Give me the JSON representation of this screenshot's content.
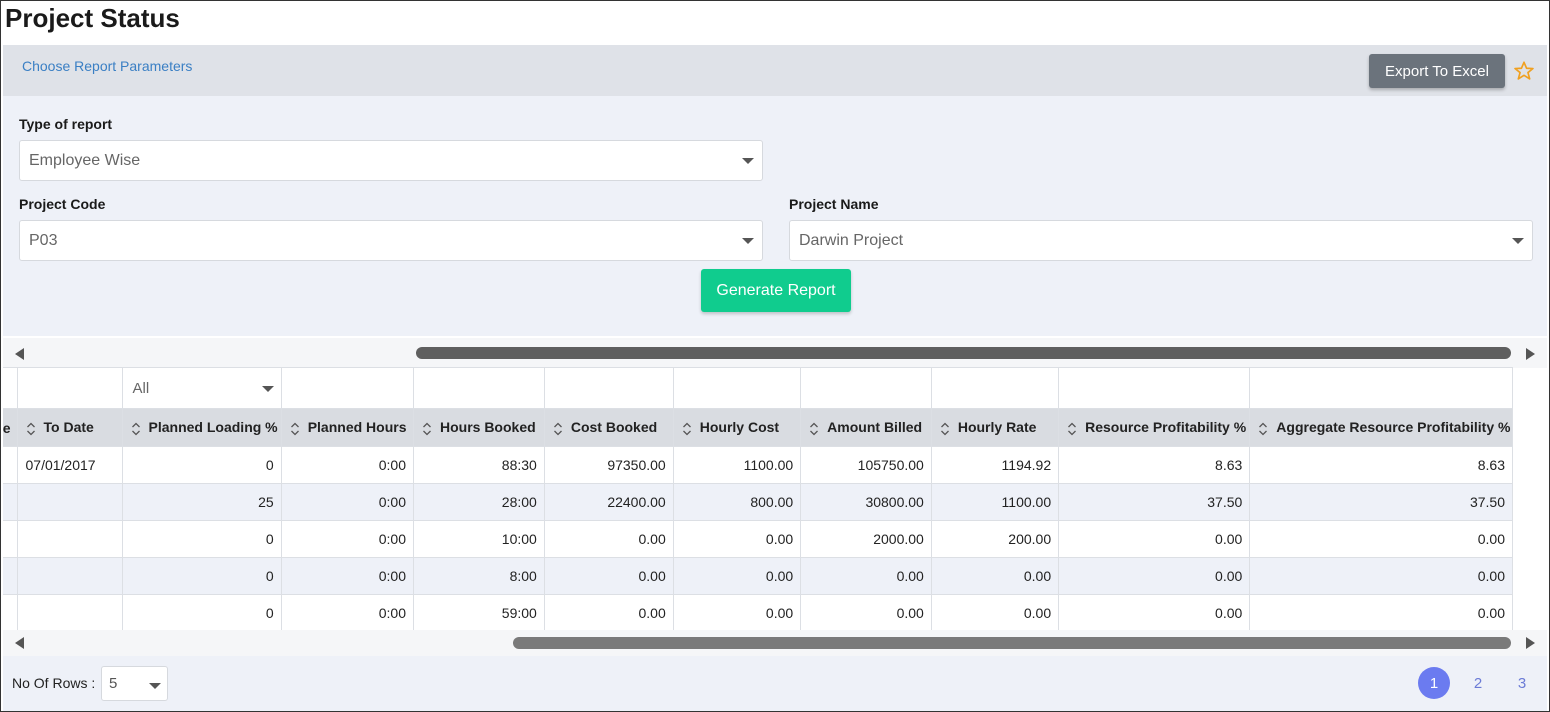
{
  "page": {
    "title": "Project Status"
  },
  "toolbar": {
    "choose_params": "Choose Report Parameters",
    "export_label": "Export To Excel"
  },
  "form": {
    "type_label": "Type of report",
    "type_value": "Employee Wise",
    "code_label": "Project Code",
    "code_value": "P03",
    "name_label": "Project Name",
    "name_value": "Darwin Project",
    "generate_label": "Generate Report"
  },
  "grid": {
    "filter_value": "All",
    "partial_header": "e",
    "columns": [
      "To Date",
      "Planned Loading %",
      "Planned Hours",
      "Hours Booked",
      "Cost Booked",
      "Hourly Cost",
      "Amount Billed",
      "Hourly Rate",
      "Resource Profitability %",
      "Aggregate Resource Profitability %"
    ],
    "rows": [
      [
        "07/01/2017",
        "0",
        "0:00",
        "88:30",
        "97350.00",
        "1100.00",
        "105750.00",
        "1194.92",
        "8.63",
        "8.63"
      ],
      [
        "",
        "25",
        "0:00",
        "28:00",
        "22400.00",
        "800.00",
        "30800.00",
        "1100.00",
        "37.50",
        "37.50"
      ],
      [
        "",
        "0",
        "0:00",
        "10:00",
        "0.00",
        "0.00",
        "2000.00",
        "200.00",
        "0.00",
        "0.00"
      ],
      [
        "",
        "0",
        "0:00",
        "8:00",
        "0.00",
        "0.00",
        "0.00",
        "0.00",
        "0.00",
        "0.00"
      ],
      [
        "",
        "0",
        "0:00",
        "59:00",
        "0.00",
        "0.00",
        "0.00",
        "0.00",
        "0.00",
        "0.00"
      ]
    ]
  },
  "footer": {
    "rows_label": "No Of Rows :",
    "rows_value": "5",
    "pages": [
      "1",
      "2",
      "3"
    ],
    "active_page": "1"
  },
  "colors": {
    "accent": "#10cc8e",
    "export": "#6b737c",
    "pager": "#6b7bf0",
    "star": "#f0a020"
  },
  "icons": [
    "star-icon",
    "sort-icon",
    "chevron-down-icon",
    "scroll-left-icon",
    "scroll-right-icon"
  ]
}
